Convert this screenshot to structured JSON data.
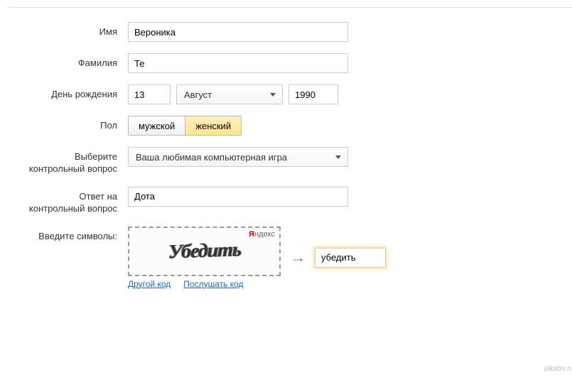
{
  "labels": {
    "first_name": "Имя",
    "last_name": "Фамилия",
    "birthday": "День рождения",
    "gender": "Пол",
    "security_question": "Выберите контрольный вопрос",
    "security_answer": "Ответ на контрольный вопрос",
    "captcha": "Введите символы:"
  },
  "values": {
    "first_name": "Вероника",
    "last_name": "Те",
    "day": "13",
    "month": "Август",
    "year": "1990",
    "question": "Ваша любимая компьютерная игра",
    "answer": "Дота",
    "captcha_input": "убедить"
  },
  "gender": {
    "male": "мужской",
    "female": "женский",
    "selected": "female"
  },
  "captcha": {
    "word": "Убедить",
    "brand_prefix": "Я",
    "brand_rest": "ндекс",
    "new_code": "Другой код",
    "listen_code": "Послушать код"
  },
  "footer": {
    "watermark": "pikabu.ru"
  }
}
